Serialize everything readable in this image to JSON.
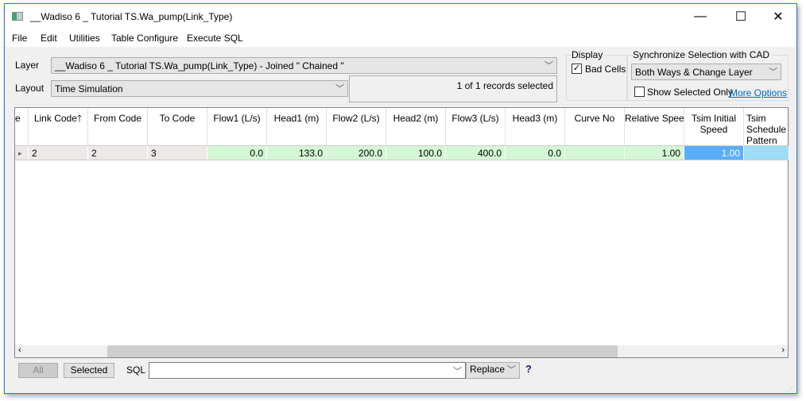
{
  "window": {
    "title": "__Wadiso 6 _ Tutorial TS.Wa_pump(Link_Type)",
    "minimize": "—",
    "maximize": "☐",
    "close": "✕"
  },
  "menu": [
    "File",
    "Edit",
    "Utilities",
    "Table Configure",
    "Execute SQL"
  ],
  "layer": {
    "label": "Layer",
    "value": "__Wadiso 6 _ Tutorial TS.Wa_pump(Link_Type) - Joined \" Chained \""
  },
  "layout": {
    "label": "Layout",
    "value": "Time Simulation"
  },
  "status": "1 of 1 records selected",
  "display": {
    "title": "Display",
    "bad_cells_label": "Bad Cells",
    "bad_cells_checked": true
  },
  "sync": {
    "title": "Synchronize Selection with CAD",
    "value": "Both Ways & Change Layer",
    "show_selected_label": "Show Selected Only",
    "show_selected_checked": false,
    "more_options": "More Options"
  },
  "table": {
    "columns": [
      "e",
      "Link Code",
      "From Code",
      "To Code",
      "Flow1 (L/s)",
      "Head1 (m)",
      "Flow2 (L/s)",
      "Head2 (m)",
      "Flow3 (L/s)",
      "Head3 (m)",
      "Curve No",
      "Relative Speed",
      "Tsim Initial Speed",
      "Tsim Schedule Pattern No"
    ],
    "rows": [
      [
        "",
        "2",
        "2",
        "3",
        "0.0",
        "133.0",
        "200.0",
        "100.0",
        "400.0",
        "0.0",
        "",
        "1.00",
        "1.00",
        ""
      ]
    ]
  },
  "bottom": {
    "all": "All",
    "selected": "Selected",
    "sql_label": "SQL",
    "sql_value": "",
    "mode": "Replace",
    "help": "?"
  },
  "colors": {
    "green_cell": "#d4f7d4",
    "selected_cell": "#5aaef9",
    "light_blue_cell": "#9fdcf5",
    "gray_cell": "#ece9e8",
    "link": "#0066cc"
  }
}
